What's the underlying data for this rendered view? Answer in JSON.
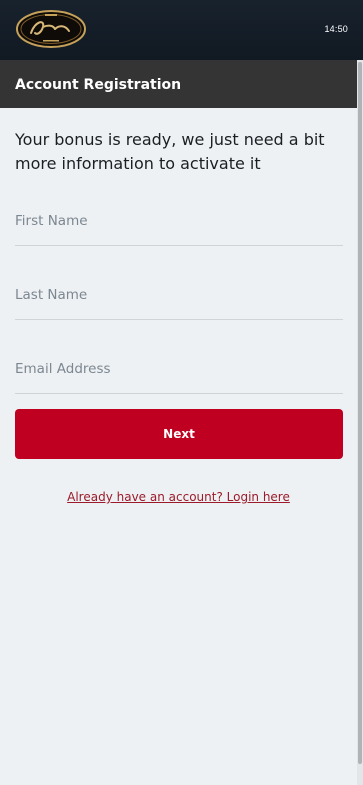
{
  "topbar": {
    "logo_icon": "grand-casino-logo",
    "time": "14:50"
  },
  "header": {
    "title": "Account Registration"
  },
  "main": {
    "intro": "Your bonus is ready, we just need a bit more information to activate it",
    "fields": [
      {
        "placeholder": "First Name"
      },
      {
        "placeholder": "Last Name"
      },
      {
        "placeholder": "Email Address"
      }
    ],
    "next_label": "Next",
    "login_link": "Already have an account? Login here"
  },
  "colors": {
    "topbar": "#111922",
    "header": "#343434",
    "background": "#eef1f3",
    "primary_button": "#bf0020",
    "link": "#9b1b2b"
  }
}
